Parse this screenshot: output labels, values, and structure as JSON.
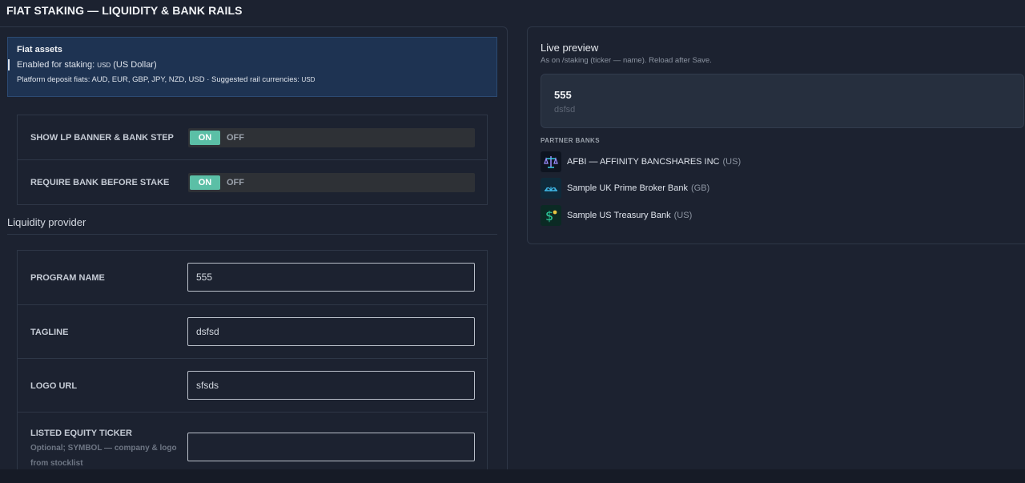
{
  "page": {
    "title": "FIAT STAKING — LIQUIDITY & BANK RAILS"
  },
  "fiat_assets": {
    "title": "Fiat assets",
    "enabled_prefix": "Enabled for staking: ",
    "enabled_code": "USD",
    "enabled_suffix": " (US Dollar)",
    "deposit_prefix": "Platform deposit fiats: AUD, EUR, GBP, JPY, NZD, USD · Suggested rail currencies: ",
    "deposit_code": "USD"
  },
  "toggles": [
    {
      "label": "SHOW LP BANNER & BANK STEP",
      "on_label": "ON",
      "off_label": "OFF",
      "state": "on"
    },
    {
      "label": "REQUIRE BANK BEFORE STAKE",
      "on_label": "ON",
      "off_label": "OFF",
      "state": "on"
    }
  ],
  "liquidity_provider": {
    "section_title": "Liquidity provider",
    "fields": [
      {
        "label": "PROGRAM NAME",
        "value": "555"
      },
      {
        "label": "TAGLINE",
        "value": "dsfsd"
      },
      {
        "label": "LOGO URL",
        "value": "sfsds"
      },
      {
        "label": "LISTED EQUITY TICKER",
        "hint": "Optional; SYMBOL — company & logo from stocklist",
        "value": ""
      }
    ]
  },
  "preview": {
    "title": "Live preview",
    "subtitle": "As on /staking (ticker — name). Reload after Save.",
    "program_name": "555",
    "tagline": "dsfsd",
    "partner_banks_title": "PARTNER BANKS",
    "banks": [
      {
        "name": "AFBI — AFFINITY BANCSHARES INC",
        "country": "(US)",
        "icon": "scales-icon"
      },
      {
        "name": "Sample UK Prime Broker Bank",
        "country": "(GB)",
        "icon": "bridge-icon"
      },
      {
        "name": "Sample US Treasury Bank",
        "country": "(US)",
        "icon": "dollar-icon"
      }
    ]
  },
  "colors": {
    "background": "#1c2230",
    "accent_on": "#5bbfa6",
    "info_box": "#1e3352"
  }
}
